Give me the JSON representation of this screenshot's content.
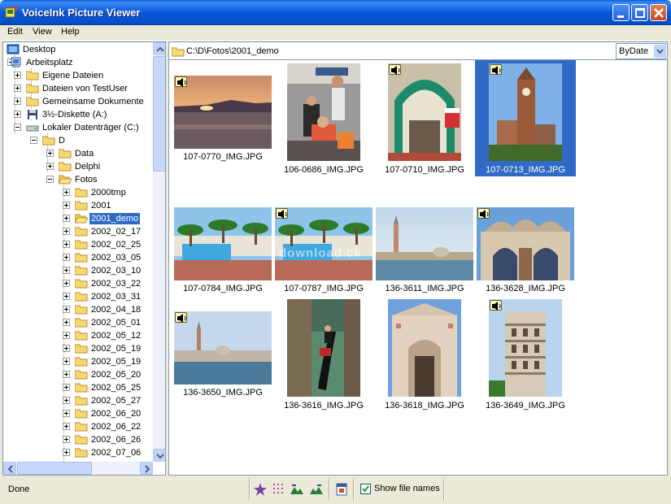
{
  "window": {
    "title": "VoiceInk Picture Viewer",
    "app_icon": "app-icon",
    "controls": [
      "minimize-icon",
      "maximize-icon",
      "close-icon"
    ]
  },
  "menu": {
    "items": [
      "Edit",
      "View",
      "Help"
    ]
  },
  "tree": {
    "items": [
      {
        "label": "Desktop",
        "icon": "desktop-icon",
        "level": 0
      },
      {
        "label": "Arbeitsplatz",
        "icon": "computer-icon",
        "level": 1
      },
      {
        "label": "Eigene Dateien",
        "icon": "folder-icon",
        "level": 2
      },
      {
        "label": "Dateien von TestUser",
        "icon": "folder-icon",
        "level": 2
      },
      {
        "label": "Gemeinsame Dokumente",
        "icon": "folder-icon",
        "level": 2
      },
      {
        "label": "3½-Diskette (A:)",
        "icon": "floppy-icon",
        "level": 2
      },
      {
        "label": "Lokaler Datenträger (C:)",
        "icon": "drive-icon",
        "level": 2
      },
      {
        "label": "D",
        "icon": "folder-icon",
        "level": 3
      },
      {
        "label": "Data",
        "icon": "folder-icon",
        "level": 4
      },
      {
        "label": "Delphi",
        "icon": "folder-icon",
        "level": 4
      },
      {
        "label": "Fotos",
        "icon": "folder-open-icon",
        "level": 4
      },
      {
        "label": "2000tmp",
        "icon": "folder-icon",
        "level": 5
      },
      {
        "label": "2001",
        "icon": "folder-icon",
        "level": 5
      },
      {
        "label": "2001_demo",
        "icon": "folder-open-icon",
        "level": 5,
        "selected": true
      },
      {
        "label": "2002_02_17",
        "icon": "folder-icon",
        "level": 5
      },
      {
        "label": "2002_02_25",
        "icon": "folder-icon",
        "level": 5
      },
      {
        "label": "2002_03_05",
        "icon": "folder-icon",
        "level": 5
      },
      {
        "label": "2002_03_10",
        "icon": "folder-icon",
        "level": 5
      },
      {
        "label": "2002_03_22",
        "icon": "folder-icon",
        "level": 5
      },
      {
        "label": "2002_03_31",
        "icon": "folder-icon",
        "level": 5
      },
      {
        "label": "2002_04_18",
        "icon": "folder-icon",
        "level": 5
      },
      {
        "label": "2002_05_01",
        "icon": "folder-icon",
        "level": 5
      },
      {
        "label": "2002_05_12",
        "icon": "folder-icon",
        "level": 5
      },
      {
        "label": "2002_05_19",
        "icon": "folder-icon",
        "level": 5
      },
      {
        "label": "2002_05_19",
        "icon": "folder-icon",
        "level": 5
      },
      {
        "label": "2002_05_20",
        "icon": "folder-icon",
        "level": 5
      },
      {
        "label": "2002_05_25",
        "icon": "folder-icon",
        "level": 5
      },
      {
        "label": "2002_05_27",
        "icon": "folder-icon",
        "level": 5
      },
      {
        "label": "2002_06_20",
        "icon": "folder-icon",
        "level": 5
      },
      {
        "label": "2002_06_22",
        "icon": "folder-icon",
        "level": 5
      },
      {
        "label": "2002_06_26",
        "icon": "folder-icon",
        "level": 5
      },
      {
        "label": "2002_07_06",
        "icon": "folder-icon",
        "level": 5
      }
    ]
  },
  "pathbar": {
    "path": "C:\\D\\Fotos\\2001_demo",
    "sort": "ByDate"
  },
  "gallery": {
    "watermark": "download.ck",
    "images": [
      {
        "name": "107-0770_IMG.JPG",
        "audio": true,
        "selected": false,
        "orientation": "landscape",
        "scene": "sunset-sea"
      },
      {
        "name": "106-0686_IMG.JPG",
        "audio": false,
        "selected": false,
        "orientation": "portrait",
        "scene": "airport-people"
      },
      {
        "name": "107-0710_IMG.JPG",
        "audio": true,
        "selected": false,
        "orientation": "portrait",
        "scene": "green-arch"
      },
      {
        "name": "107-0713_IMG.JPG",
        "audio": true,
        "selected": true,
        "orientation": "portrait",
        "scene": "church-tower"
      },
      {
        "name": "107-0784_IMG.JPG",
        "audio": false,
        "selected": false,
        "orientation": "landscape",
        "scene": "pool-palms"
      },
      {
        "name": "107-0787_IMG.JPG",
        "audio": true,
        "selected": false,
        "orientation": "landscape",
        "scene": "pool-palms"
      },
      {
        "name": "136-3611_IMG.JPG",
        "audio": false,
        "selected": false,
        "orientation": "landscape",
        "scene": "venice-lagoon"
      },
      {
        "name": "136-3628_IMG.JPG",
        "audio": true,
        "selected": false,
        "orientation": "landscape",
        "scene": "basilica"
      },
      {
        "name": "136-3650_IMG.JPG",
        "audio": true,
        "selected": false,
        "orientation": "landscape",
        "scene": "venice-lagoon-wide"
      },
      {
        "name": "136-3616_IMG.JPG",
        "audio": false,
        "selected": false,
        "orientation": "portrait",
        "scene": "gondola"
      },
      {
        "name": "136-3618_IMG.JPG",
        "audio": false,
        "selected": false,
        "orientation": "portrait",
        "scene": "palace-facade"
      },
      {
        "name": "136-3649_IMG.JPG",
        "audio": true,
        "selected": false,
        "orientation": "portrait",
        "scene": "spiral-tower"
      }
    ]
  },
  "status": {
    "text": "Done",
    "toolbar_icons": [
      "star-icon",
      "grid-icon",
      "landscape-left-icon",
      "landscape-right-icon",
      "calendar-icon"
    ],
    "show_file_names_label": "Show file names",
    "show_file_names_checked": true
  },
  "colors": {
    "selection": "#316AC5",
    "titlebar": "#0A5FD6",
    "chrome": "#ECE9D8"
  }
}
